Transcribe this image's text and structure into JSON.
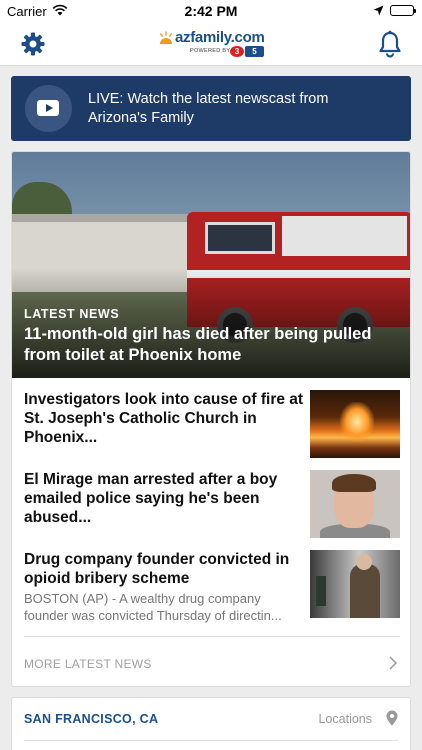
{
  "status_bar": {
    "carrier": "Carrier",
    "time": "2:42 PM"
  },
  "header": {
    "logo_text": "azfamily.com",
    "logo_powered": "POWERED BY",
    "logo_channel_a": "3",
    "logo_channel_b": "5"
  },
  "live_banner": {
    "text": "LIVE: Watch the latest newscast from Arizona's Family"
  },
  "featured": {
    "kicker": "LATEST NEWS",
    "headline": "11-month-old girl has died after being pulled from toilet at Phoenix home"
  },
  "stories": [
    {
      "title": "Investigators look into cause of fire at St. Joseph's Catholic Church in Phoenix...",
      "summary": ""
    },
    {
      "title": "El Mirage man arrested after a boy emailed police saying he's been abused...",
      "summary": ""
    },
    {
      "title": "Drug company founder convicted in opioid bribery scheme",
      "summary": "BOSTON (AP) - A wealthy drug company founder was convicted Thursday of directin..."
    }
  ],
  "more_link": "MORE LATEST NEWS",
  "location": {
    "city": "SAN FRANCISCO, CA",
    "locations_label": "Locations"
  },
  "colors": {
    "brand_blue": "#1c4f8a",
    "banner_navy": "#1e3a66",
    "page_background": "#ececec"
  },
  "icons": {
    "settings": "gear-icon",
    "notifications": "bell-icon",
    "play": "play-icon",
    "chevron": "chevron-right-icon",
    "pin": "map-pin-icon"
  }
}
